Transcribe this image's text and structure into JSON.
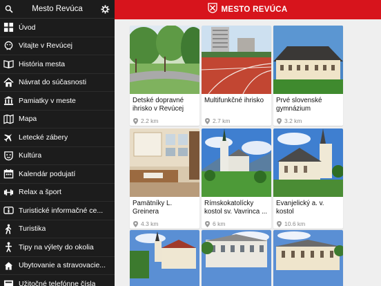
{
  "sidebar": {
    "title": "Mesto Revúca",
    "items": [
      {
        "label": "Úvod",
        "icon": "grid-icon"
      },
      {
        "label": "Vitajte v Revúcej",
        "icon": "face-icon"
      },
      {
        "label": "História mesta",
        "icon": "book-icon"
      },
      {
        "label": "Návrat do súčasnosti",
        "icon": "home-icon"
      },
      {
        "label": "Pamiatky v meste",
        "icon": "monument-icon"
      },
      {
        "label": "Mapa",
        "icon": "map-icon"
      },
      {
        "label": "Letecké zábery",
        "icon": "plane-icon"
      },
      {
        "label": "Kultúra",
        "icon": "masks-icon"
      },
      {
        "label": "Kalendár podujatí",
        "icon": "calendar-icon"
      },
      {
        "label": "Relax a šport",
        "icon": "dumbbell-icon"
      },
      {
        "label": "Turistické informačné ce...",
        "icon": "info-icon"
      },
      {
        "label": "Turistika",
        "icon": "hiker-icon"
      },
      {
        "label": "Tipy na výlety do okolia",
        "icon": "person-icon"
      },
      {
        "label": "Ubytovanie a stravovacie...",
        "icon": "hotel-icon"
      },
      {
        "label": "Užitočné telefónne čísla",
        "icon": "phone-icon"
      }
    ]
  },
  "header": {
    "brand": "MESTO REVÚCA"
  },
  "cards": [
    {
      "name": "Detské dopravné ihrisko v Revúcej",
      "distance": "2.2 km"
    },
    {
      "name": "Multifunkčné ihrisko",
      "distance": "2.7 km"
    },
    {
      "name": "Prvé slovenské gymnázium",
      "distance": "3.2 km"
    },
    {
      "name": "Pamätníky L. Greinera",
      "distance": "4.3 km"
    },
    {
      "name": "Rímskokatolícky kostol sv. Vavrinca ...",
      "distance": "6 km"
    },
    {
      "name": "Evanjelický a. v. kostol",
      "distance": "10.6 km"
    },
    {
      "name": "",
      "distance": ""
    },
    {
      "name": "",
      "distance": ""
    },
    {
      "name": "",
      "distance": ""
    }
  ],
  "colors": {
    "accent": "#d7141c",
    "sidebar": "#1c1c1c"
  }
}
